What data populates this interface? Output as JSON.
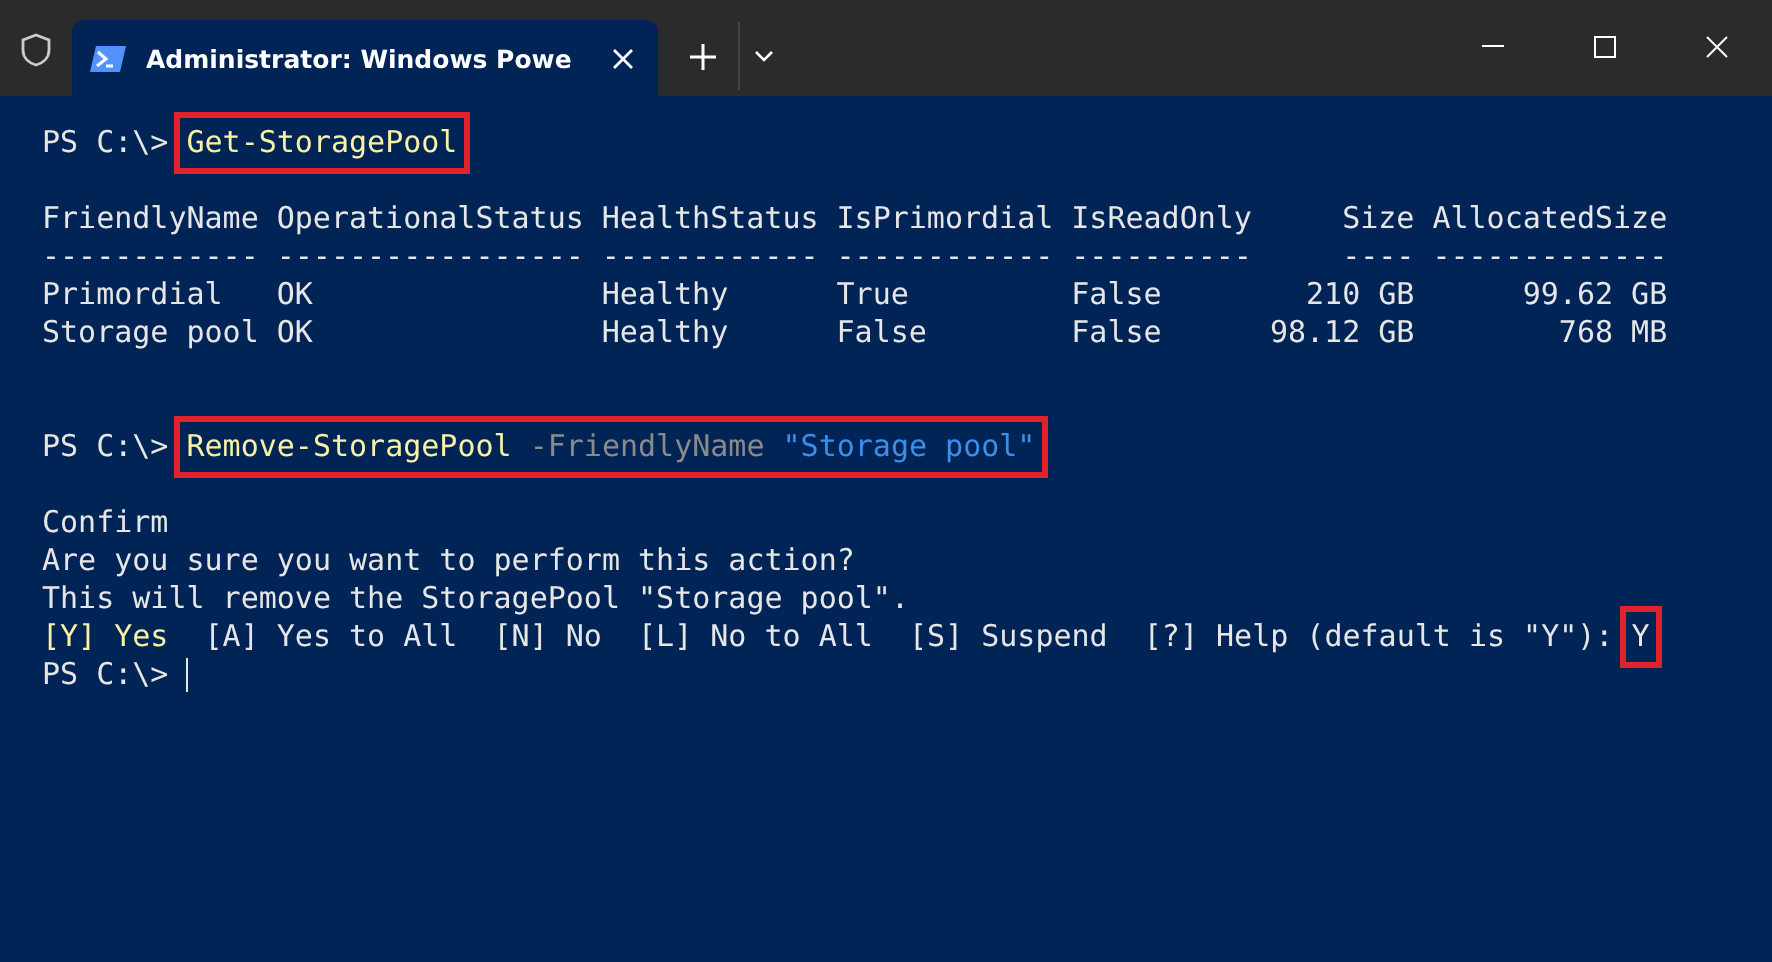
{
  "window": {
    "tab": {
      "title": "Administrator: Windows Powe",
      "selected": true
    }
  },
  "terminal": [
    {
      "kind": "prompt",
      "prompt": "PS C:\\>",
      "command": "Get-StoragePool",
      "highlighted": true
    },
    {
      "kind": "blank"
    },
    {
      "kind": "table",
      "columns": [
        {
          "header": "FriendlyName",
          "rule": "------------",
          "kind": "text"
        },
        {
          "header": "OperationalStatus",
          "rule": "-----------------",
          "kind": "text"
        },
        {
          "header": "HealthStatus",
          "rule": "------------",
          "kind": "text"
        },
        {
          "header": "IsPrimordial",
          "rule": "------------",
          "kind": "text"
        },
        {
          "header": "IsReadOnly",
          "rule": "----------",
          "kind": "text"
        },
        {
          "header": "Size",
          "rule": "----",
          "kind": "size"
        },
        {
          "header": "AllocatedSize",
          "rule": "-------------",
          "kind": "size"
        }
      ],
      "rows": [
        [
          "Primordial",
          "OK",
          "Healthy",
          "True",
          "False",
          "210 GB",
          "99.62 GB"
        ],
        [
          "Storage pool",
          "OK",
          "Healthy",
          "False",
          "False",
          "98.12 GB",
          "768 MB"
        ]
      ]
    },
    {
      "kind": "blank"
    },
    {
      "kind": "blank"
    },
    {
      "kind": "prompt",
      "prompt": "PS C:\\>",
      "command": "Remove-StoragePool",
      "args": [
        {
          "kind": "parameter",
          "text": "-FriendlyName"
        },
        {
          "kind": "string",
          "text": "\"Storage pool\""
        }
      ],
      "highlighted": true
    },
    {
      "kind": "blank"
    },
    {
      "kind": "text",
      "text": "Confirm"
    },
    {
      "kind": "text",
      "text": "Are you sure you want to perform this action?"
    },
    {
      "kind": "text",
      "text": "This will remove the StoragePool \"Storage pool\"."
    },
    {
      "kind": "choices",
      "choices": [
        {
          "text": "[Y] Yes",
          "default": true
        },
        {
          "text": "[A] Yes to All",
          "default": false
        },
        {
          "text": "[N] No",
          "default": false
        },
        {
          "text": "[L] No to All",
          "default": false
        },
        {
          "text": "[S] Suspend",
          "default": false
        }
      ],
      "help": "[?] Help (default is \"Y\"):",
      "answer": "Y",
      "highlighted": true
    },
    {
      "kind": "prompt",
      "prompt": "PS C:\\>",
      "cursor": true
    }
  ]
}
